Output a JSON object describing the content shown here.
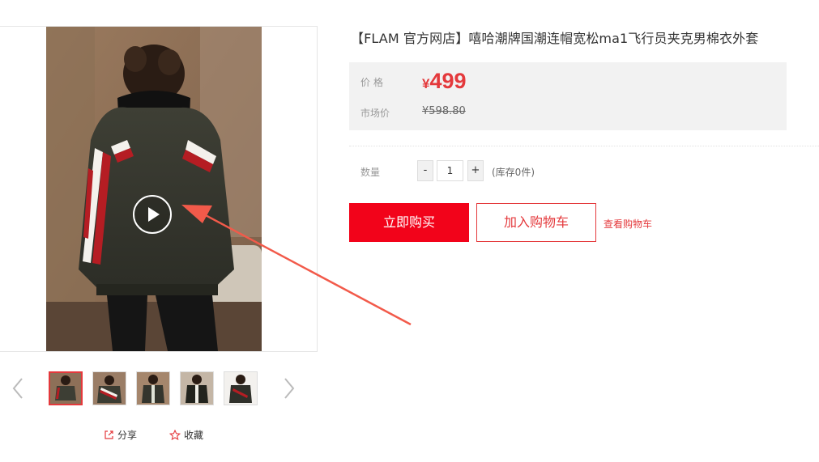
{
  "product": {
    "title": "【FLAM 官方网店】嘻哈潮牌国潮连帽宽松ma1飞行员夹克男棉衣外套"
  },
  "price_box": {
    "price_label": "价格",
    "currency": "¥",
    "price": "499",
    "market_label": "市场价",
    "market_price": "¥598.80"
  },
  "quantity": {
    "label": "数量",
    "minus": "-",
    "value": "1",
    "plus": "+",
    "stock": "(库存0件)"
  },
  "actions": {
    "buy_now": "立即购买",
    "add_to_cart": "加入购物车",
    "view_cart": "查看购物车"
  },
  "gallery": {
    "thumbnail_count": 5,
    "active_index": 0
  },
  "social": {
    "share": "分享",
    "favorite": "收藏"
  },
  "colors": {
    "accent_red": "#e4393c",
    "buy_button_red": "#f2031a",
    "price_box_bg": "#f2f2f2",
    "annotation_arrow": "#f25a4a"
  },
  "icons": {
    "play": "play-icon",
    "prev": "chevron-left-icon",
    "next": "chevron-right-icon",
    "share": "share-icon",
    "favorite": "star-icon"
  }
}
